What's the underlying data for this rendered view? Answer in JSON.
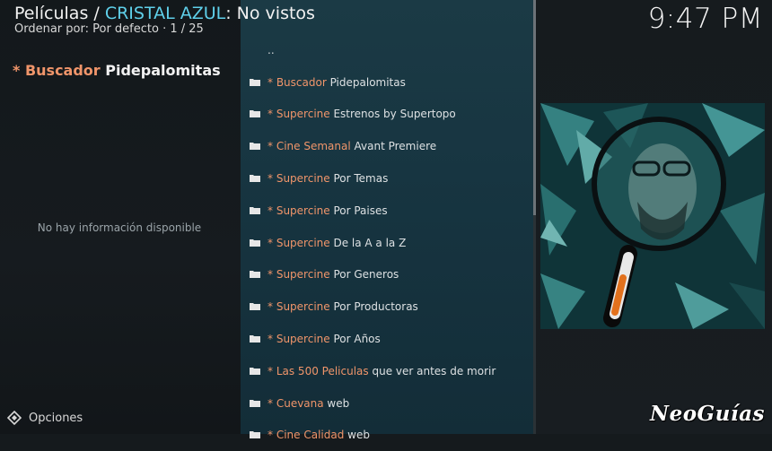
{
  "header": {
    "path_prefix": "Películas / ",
    "path_accent": "CRISTAL AZUL",
    "path_suffix": ": No vistos",
    "sort_text": "Ordenar por: Por defecto  ·  1 / 25",
    "clock": "9:47 PM"
  },
  "selected": {
    "star": "*",
    "accent": "Buscador",
    "rest": "Pidepalomitas",
    "no_info": "No hay información disponible"
  },
  "list": {
    "parent": "..",
    "items": [
      {
        "star": "* ",
        "accent": "Buscador",
        "rest": " Pidepalomitas"
      },
      {
        "star": "* ",
        "accent": "Supercine",
        "rest": " Estrenos by Supertopo"
      },
      {
        "star": "* ",
        "accent": "Cine Semanal",
        "rest": " Avant Premiere"
      },
      {
        "star": "* ",
        "accent": "Supercine",
        "rest": " Por Temas"
      },
      {
        "star": "* ",
        "accent": "Supercine",
        "rest": " Por Paises"
      },
      {
        "star": "* ",
        "accent": "Supercine",
        "rest": " De la A a la Z"
      },
      {
        "star": "* ",
        "accent": "Supercine",
        "rest": " Por Generos"
      },
      {
        "star": "* ",
        "accent": "Supercine",
        "rest": " Por Productoras"
      },
      {
        "star": "* ",
        "accent": "Supercine",
        "rest": " Por Años"
      },
      {
        "star": "* ",
        "accent": "Las 500 Peliculas",
        "rest": " que ver antes de morir"
      },
      {
        "star": "* ",
        "accent": "Cuevana",
        "rest": " web"
      },
      {
        "star": "* ",
        "accent": "Cine Calidad",
        "rest": " web"
      }
    ]
  },
  "footer": {
    "options_label": "Opciones",
    "watermark": "NeoGuías"
  },
  "colors": {
    "accent_orange": "#f0956a",
    "accent_cyan": "#5fd0ea",
    "list_bg": "#173541"
  },
  "icons": {
    "folder": "folder-icon",
    "options": "options-icon",
    "poster": "magnifier-portrait-thumbnail"
  }
}
